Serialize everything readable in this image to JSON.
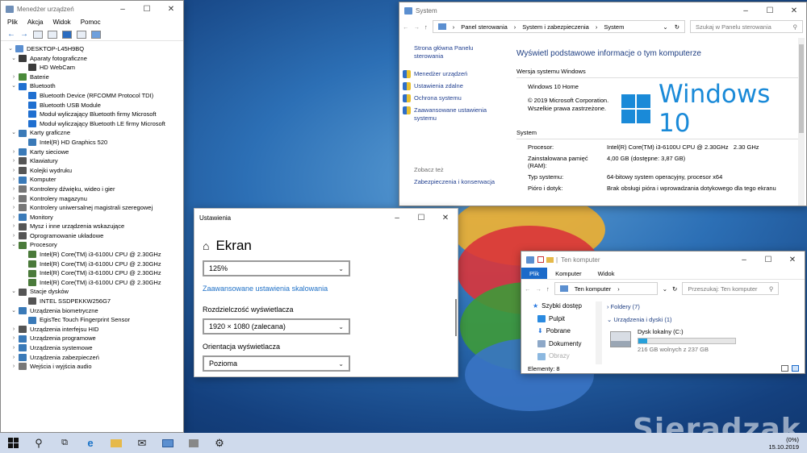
{
  "device_manager": {
    "title": "Menedżer urządzeń",
    "menu": [
      "Plik",
      "Akcja",
      "Widok",
      "Pomoc"
    ],
    "root": "DESKTOP-L45H9BQ",
    "tree": [
      {
        "label": "Aparaty fotograficzne",
        "level": 1,
        "expanded": true,
        "color": "#3b3b3b"
      },
      {
        "label": "HD WebCam",
        "level": 2,
        "color": "#3b3b3b"
      },
      {
        "label": "Baterie",
        "level": 1,
        "expanded": false,
        "color": "#4a8a3a"
      },
      {
        "label": "Bluetooth",
        "level": 1,
        "expanded": true,
        "color": "#1f6fd0"
      },
      {
        "label": "Bluetooth Device (RFCOMM Protocol TDI)",
        "level": 2,
        "color": "#1f6fd0"
      },
      {
        "label": "Bluetooth USB Module",
        "level": 2,
        "color": "#1f6fd0"
      },
      {
        "label": "Moduł wyliczający Bluetooth firmy Microsoft",
        "level": 2,
        "color": "#1f6fd0"
      },
      {
        "label": "Moduł wyliczający Bluetooth LE firmy Microsoft",
        "level": 2,
        "color": "#1f6fd0"
      },
      {
        "label": "Karty graficzne",
        "level": 1,
        "expanded": true,
        "color": "#3a7ab8"
      },
      {
        "label": "Intel(R) HD Graphics 520",
        "level": 2,
        "color": "#3a7ab8"
      },
      {
        "label": "Karty sieciowe",
        "level": 1,
        "expanded": false,
        "color": "#3a7ab8"
      },
      {
        "label": "Klawiatury",
        "level": 1,
        "expanded": false,
        "color": "#555"
      },
      {
        "label": "Kolejki wydruku",
        "level": 1,
        "expanded": false,
        "color": "#555"
      },
      {
        "label": "Komputer",
        "level": 1,
        "expanded": false,
        "color": "#3a7ab8"
      },
      {
        "label": "Kontrolery dźwięku, wideo i gier",
        "level": 1,
        "expanded": false,
        "color": "#777"
      },
      {
        "label": "Kontrolery magazynu",
        "level": 1,
        "expanded": false,
        "color": "#777"
      },
      {
        "label": "Kontrolery uniwersalnej magistrali szeregowej",
        "level": 1,
        "expanded": false,
        "color": "#777"
      },
      {
        "label": "Monitory",
        "level": 1,
        "expanded": false,
        "color": "#3a7ab8"
      },
      {
        "label": "Mysz i inne urządzenia wskazujące",
        "level": 1,
        "expanded": false,
        "color": "#555"
      },
      {
        "label": "Oprogramowanie układowe",
        "level": 1,
        "expanded": false,
        "color": "#555"
      },
      {
        "label": "Procesory",
        "level": 1,
        "expanded": true,
        "color": "#4a7a3a"
      },
      {
        "label": "Intel(R) Core(TM) i3-6100U CPU @ 2.30GHz",
        "level": 2,
        "color": "#4a7a3a"
      },
      {
        "label": "Intel(R) Core(TM) i3-6100U CPU @ 2.30GHz",
        "level": 2,
        "color": "#4a7a3a"
      },
      {
        "label": "Intel(R) Core(TM) i3-6100U CPU @ 2.30GHz",
        "level": 2,
        "color": "#4a7a3a"
      },
      {
        "label": "Intel(R) Core(TM) i3-6100U CPU @ 2.30GHz",
        "level": 2,
        "color": "#4a7a3a"
      },
      {
        "label": "Stacje dysków",
        "level": 1,
        "expanded": true,
        "color": "#555"
      },
      {
        "label": "INTEL SSDPEKKW256G7",
        "level": 2,
        "color": "#555"
      },
      {
        "label": "Urządzenia biometryczne",
        "level": 1,
        "expanded": true,
        "color": "#3a7ab8"
      },
      {
        "label": "EgisTec Touch Fingerprint Sensor",
        "level": 2,
        "color": "#3a7ab8"
      },
      {
        "label": "Urządzenia interfejsu HID",
        "level": 1,
        "expanded": false,
        "color": "#555"
      },
      {
        "label": "Urządzenia programowe",
        "level": 1,
        "expanded": false,
        "color": "#3a7ab8"
      },
      {
        "label": "Urządzenia systemowe",
        "level": 1,
        "expanded": false,
        "color": "#3a7ab8"
      },
      {
        "label": "Urządzenia zabezpieczeń",
        "level": 1,
        "expanded": false,
        "color": "#3a7ab8"
      },
      {
        "label": "Wejścia i wyjścia audio",
        "level": 1,
        "expanded": false,
        "color": "#777"
      }
    ]
  },
  "system_window": {
    "title": "System",
    "breadcrumb": [
      "Panel sterowania",
      "System i zabezpieczenia",
      "System"
    ],
    "search_placeholder": "Szukaj w Panelu sterowania",
    "left_links": {
      "home": "Strona główna Panelu sterowania",
      "items": [
        "Menedżer urządzeń",
        "Ustawienia zdalne",
        "Ochrona systemu",
        "Zaawansowane ustawienia systemu"
      ],
      "see_also": "Zobacz też",
      "security": "Zabezpieczenia i konserwacja"
    },
    "heading": "Wyświetl podstawowe informacje o tym komputerze",
    "edition_section": "Wersja systemu Windows",
    "edition": "Windows 10 Home",
    "copyright": "© 2019 Microsoft Corporation. Wszelkie prawa zastrzeżone.",
    "logo_text": "Windows 10",
    "system_section": "System",
    "rows": [
      {
        "label": "Procesor:",
        "value": "Intel(R) Core(TM) i3-6100U CPU @ 2.30GHz   2.30 GHz"
      },
      {
        "label": "Zainstalowana pamięć (RAM):",
        "value": "4,00 GB (dostępne: 3,87 GB)"
      },
      {
        "label": "Typ systemu:",
        "value": "64-bitowy system operacyjny, procesor x64"
      },
      {
        "label": "Pióro i dotyk:",
        "value": "Brak obsługi pióra i wprowadzania dotykowego dla tego ekranu"
      }
    ]
  },
  "settings": {
    "title": "Ustawienia",
    "page_title": "Ekran",
    "scale_value": "125%",
    "advanced_link": "Zaawansowane ustawienia skalowania",
    "resolution_label": "Rozdzielczość wyświetlacza",
    "resolution_value": "1920 × 1080 (zalecana)",
    "orientation_label": "Orientacja wyświetlacza",
    "orientation_value": "Pozioma"
  },
  "explorer": {
    "title": "Ten komputer",
    "ribbon_tabs": [
      "Plik",
      "Komputer",
      "Widok"
    ],
    "address": "Ten komputer",
    "search_placeholder": "Przeszukaj: Ten komputer",
    "nav": [
      "Szybki dostęp",
      "Pulpit",
      "Pobrane",
      "Dokumenty",
      "Obrazy"
    ],
    "folders_header": "Foldery (7)",
    "drives_header": "Urządzenia i dyski (1)",
    "drive_name": "Dysk lokalny (C:)",
    "drive_free": "216 GB wolnych z 237 GB",
    "drive_used_fraction": 0.09,
    "status": "Elementy: 8"
  },
  "taskbar": {
    "date": "15.10.2019",
    "tray_text": "(0%)"
  },
  "watermark": "Sieradzak.pl"
}
